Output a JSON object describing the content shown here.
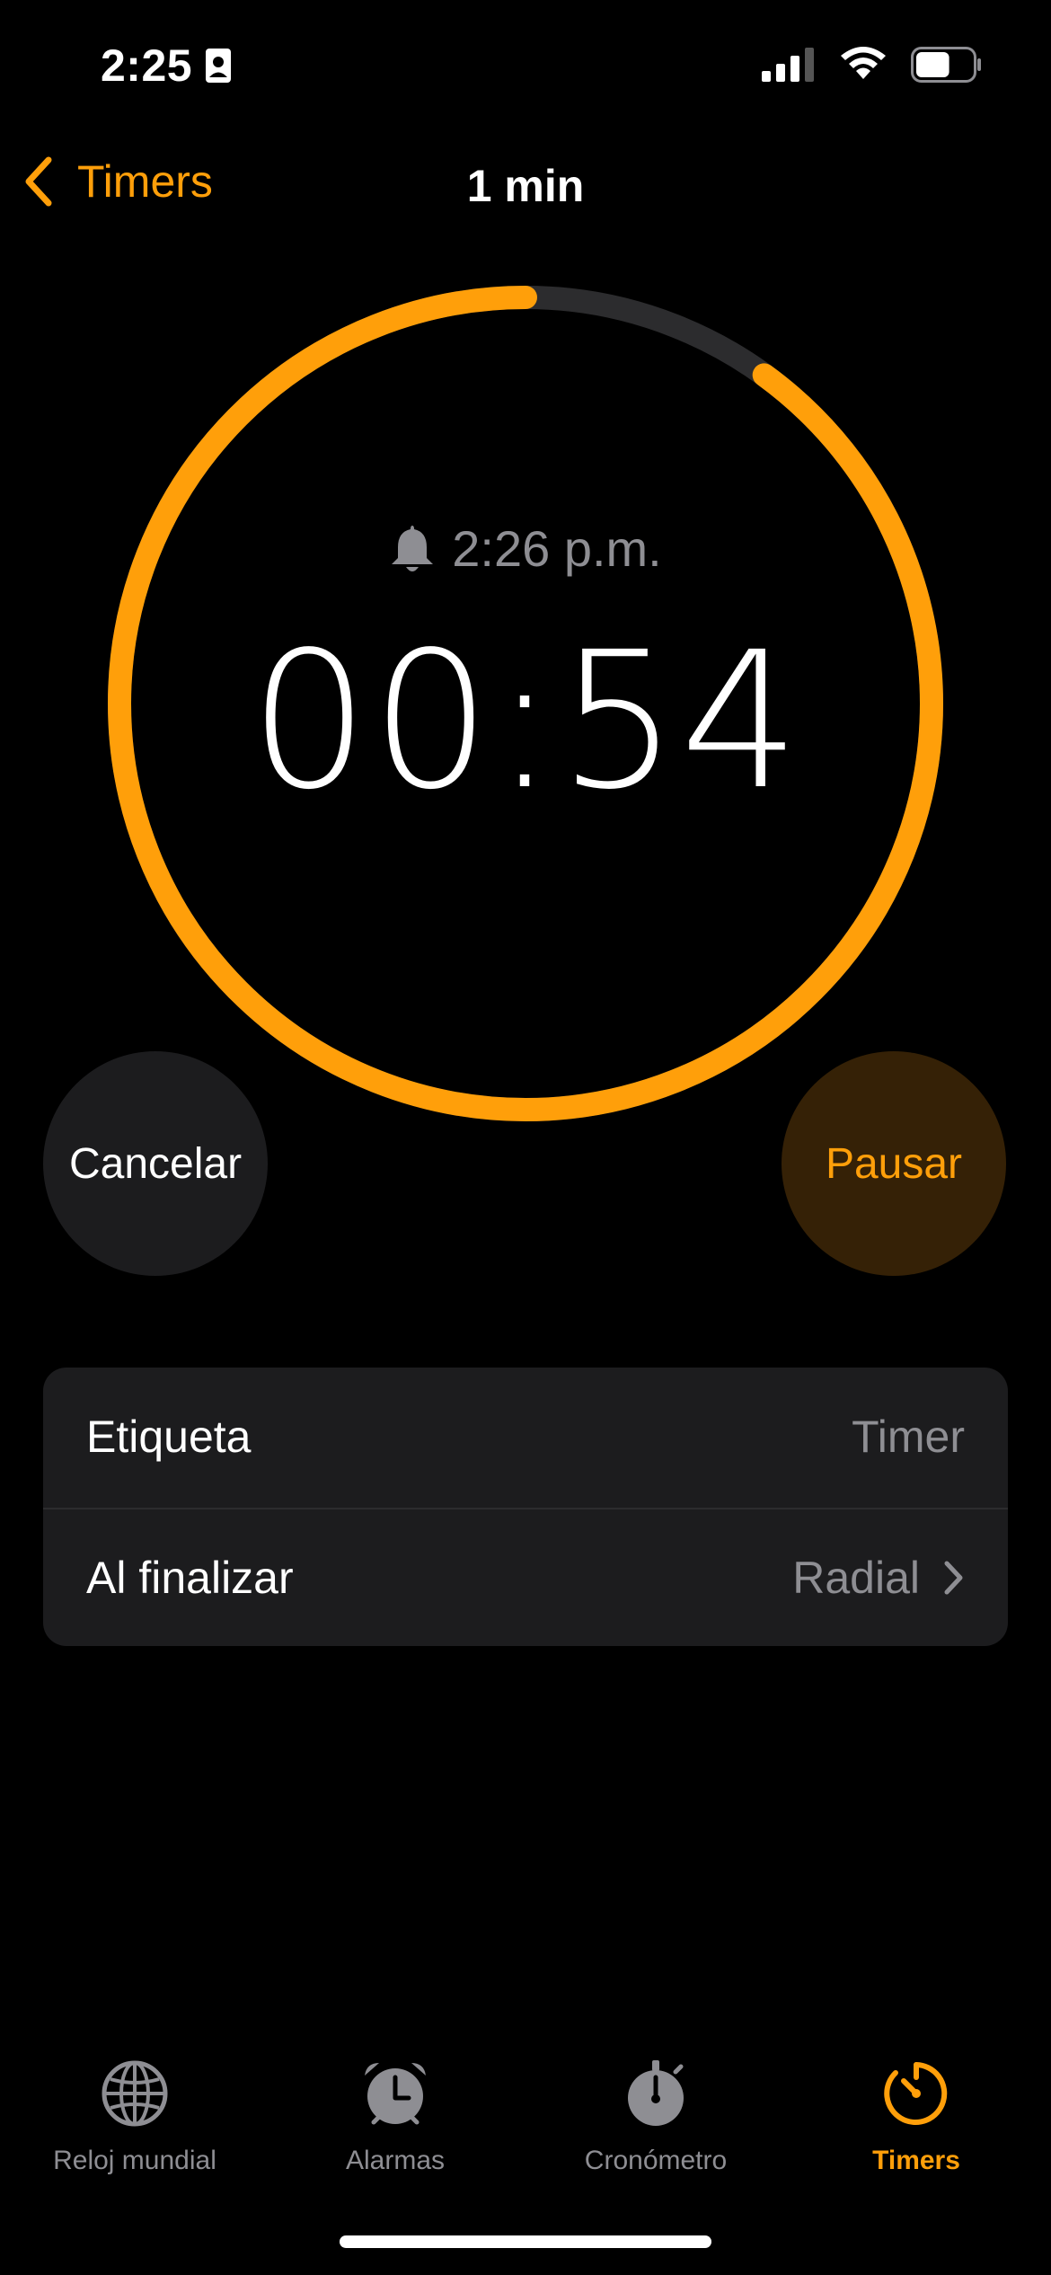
{
  "status": {
    "time": "2:25",
    "battery_level": 0.6
  },
  "nav": {
    "back_label": "Timers",
    "title": "1 min"
  },
  "timer": {
    "alarm_time": "2:26 p.m.",
    "remaining": "00:54",
    "remaining_fraction": 0.9
  },
  "buttons": {
    "cancel": "Cancelar",
    "pause": "Pausar"
  },
  "settings": [
    {
      "label": "Etiqueta",
      "value": "Timer"
    },
    {
      "label": "Al finalizar",
      "value": "Radial"
    }
  ],
  "tabs": [
    {
      "label": "Reloj mundial",
      "icon": "globe-icon",
      "active": false
    },
    {
      "label": "Alarmas",
      "icon": "alarm-clock-icon",
      "active": false
    },
    {
      "label": "Cronómetro",
      "icon": "stopwatch-icon",
      "active": false
    },
    {
      "label": "Timers",
      "icon": "timer-icon",
      "active": true
    }
  ],
  "colors": {
    "accent": "#ff9f0a",
    "track": "#2c2c2e",
    "secondary_text": "#8e8e93",
    "card": "#1c1c1e"
  }
}
